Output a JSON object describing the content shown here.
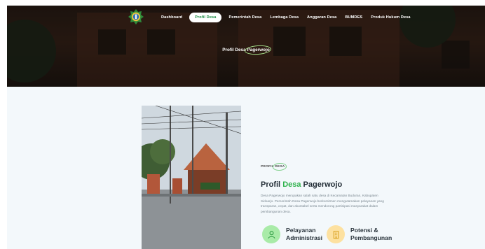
{
  "nav": {
    "items": [
      {
        "label": "Dashboard",
        "active": false
      },
      {
        "label": "Profil Desa",
        "active": true
      },
      {
        "label": "Pemerintah Desa",
        "active": false
      },
      {
        "label": "Lembaga Desa",
        "active": false
      },
      {
        "label": "Anggaran Desa",
        "active": false
      },
      {
        "label": "BUMDES",
        "active": false
      },
      {
        "label": "Produk Hukum Desa",
        "active": false
      }
    ]
  },
  "hero": {
    "title_prefix": "Profil Desa",
    "title_highlight": "Pagerwojo"
  },
  "about": {
    "badge_prefix": "PROFIL",
    "badge_highlight": "DESA",
    "title_prefix": "Profil",
    "title_highlight": "Desa",
    "title_suffix": "Pagerwojo",
    "description": "Desa Pagerwojo merupakan salah satu desa di Kecamatan Buduran, Kabupaten Sidoarjo. Pemerintah Desa Pagerwojo berkomitmen mengutamakan pelayanan yang transparan, cepat, dan akuntabel serta mendorong partisipasi masyarakat dalam pembangunan desa.",
    "features": [
      {
        "line1": "Pelayanan",
        "line2": "Administrasi",
        "icon": "user-service-icon"
      },
      {
        "line1": "Potensi &",
        "line2": "Pembangunan",
        "icon": "building-icon"
      }
    ]
  },
  "colors": {
    "accent_green": "#2fb24d",
    "nav_active_text": "#1c8c43",
    "feature_green_bg": "#a9eba8",
    "feature_yellow_bg": "#fde1a0"
  }
}
